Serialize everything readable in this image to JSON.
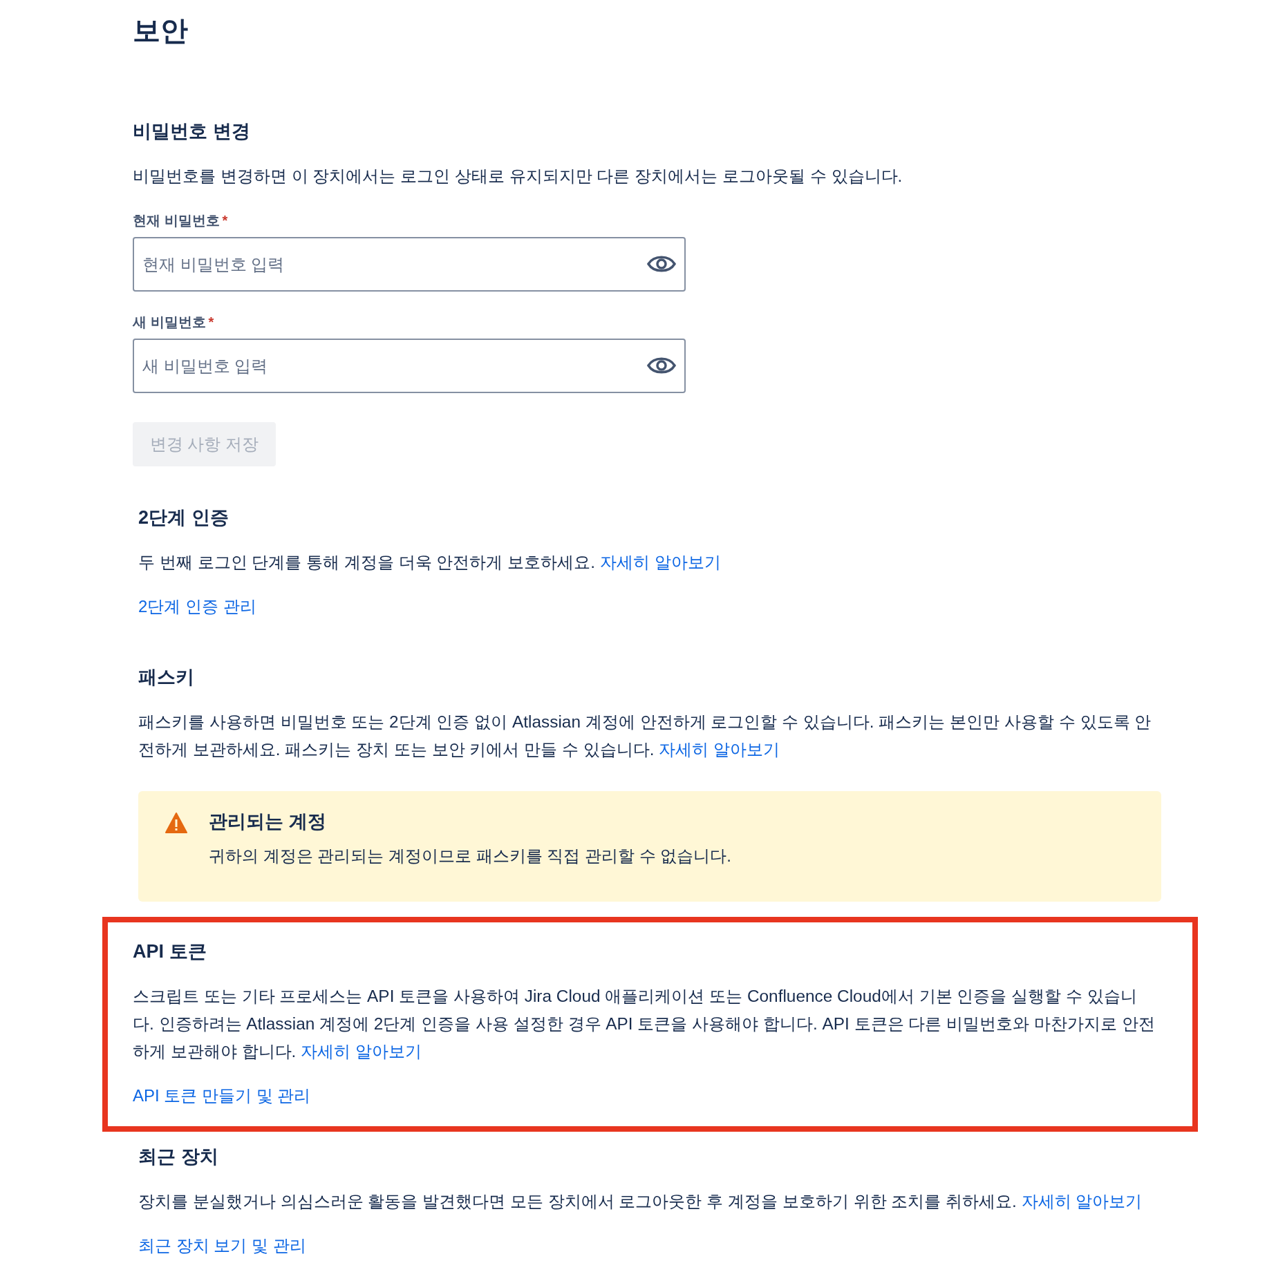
{
  "title": "보안",
  "password": {
    "heading": "비밀번호 변경",
    "description": "비밀번호를 변경하면 이 장치에서는 로그인 상태로 유지되지만 다른 장치에서는 로그아웃될 수 있습니다.",
    "fields": [
      {
        "label": "현재 비밀번호",
        "required": "*",
        "placeholder": "현재 비밀번호 입력"
      },
      {
        "label": "새 비밀번호",
        "required": "*",
        "placeholder": "새 비밀번호 입력"
      }
    ],
    "save_button": {
      "label": "변경 사항 저장",
      "disabled": true
    }
  },
  "sections": [
    {
      "heading": "2단계 인증",
      "text": "두 번째 로그인 단계를 통해 계정을 더욱 안전하게 보호하세요.",
      "link": "자세히 알아보기",
      "action": "2단계 인증 관리",
      "highlighted": false
    },
    {
      "heading": "패스키",
      "text": "패스키를 사용하면 비밀번호 또는 2단계 인증 없이 Atlassian 계정에 안전하게 로그인할 수 있습니다. 패스키는 본인만 사용할 수 있도록 안전하게 보관하세요. 패스키는 장치 또는 보안 키에서 만들 수 있습니다.",
      "link": "자세히 알아보기",
      "warning": {
        "title": "관리되는 계정",
        "message": "귀하의 계정은 관리되는 계정이므로 패스키를 직접 관리할 수 없습니다."
      },
      "highlighted": false
    },
    {
      "heading": "API 토큰",
      "text": "스크립트 또는 기타 프로세스는 API 토큰을 사용하여 Jira Cloud 애플리케이션 또는 Confluence Cloud에서 기본 인증을 실행할 수 있습니다. 인증하려는 Atlassian 계정에 2단계 인증을 사용 설정한 경우 API 토큰을 사용해야 합니다. API 토큰은 다른 비밀번호와 마찬가지로 안전하게 보관해야 합니다.",
      "link": "자세히 알아보기",
      "action": "API 토큰 만들기 및 관리",
      "highlighted": true
    },
    {
      "heading": "최근 장치",
      "text": "장치를 분실했거나 의심스러운 활동을 발견했다면 모든 장치에서 로그아웃한 후 계정을 보호하기 위한 조치를 취하세요.",
      "link": "자세히 알아보기",
      "action": "최근 장치 보기 및 관리",
      "highlighted": false
    }
  ]
}
